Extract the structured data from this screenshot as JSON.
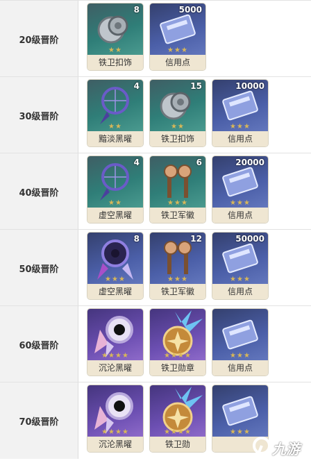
{
  "rows": [
    {
      "label": "20级晋阶",
      "items": [
        {
          "name": "铁卫扣饰",
          "count": "8",
          "icon": "coin-icon"
        },
        {
          "name": "信用点",
          "count": "5000",
          "icon": "credit-card-icon"
        }
      ]
    },
    {
      "label": "30级晋阶",
      "items": [
        {
          "name": "黯淡黑曜",
          "count": "4",
          "icon": "dreamcatcher-icon"
        },
        {
          "name": "铁卫扣饰",
          "count": "15",
          "icon": "coin-icon"
        },
        {
          "name": "信用点",
          "count": "10000",
          "icon": "credit-card-icon"
        }
      ]
    },
    {
      "label": "40级晋阶",
      "items": [
        {
          "name": "虚空黑曜",
          "count": "4",
          "icon": "dreamcatcher-icon"
        },
        {
          "name": "铁卫军徽",
          "count": "6",
          "icon": "insignia-icon"
        },
        {
          "name": "信用点",
          "count": "20000",
          "icon": "credit-card-icon"
        }
      ]
    },
    {
      "label": "50级晋阶",
      "items": [
        {
          "name": "虚空黑曜",
          "count": "8",
          "icon": "dreamcatcher-icon"
        },
        {
          "name": "铁卫军徽",
          "count": "12",
          "icon": "insignia-icon"
        },
        {
          "name": "信用点",
          "count": "50000",
          "icon": "credit-card-icon"
        }
      ]
    },
    {
      "label": "60级晋阶",
      "items": [
        {
          "name": "沉沦黑曜",
          "count": "",
          "icon": "dreamcatcher-icon"
        },
        {
          "name": "铁卫勋章",
          "count": "",
          "icon": "medal-icon"
        },
        {
          "name": "信用点",
          "count": "",
          "icon": "credit-card-icon"
        }
      ]
    },
    {
      "label": "70级晋阶",
      "items": [
        {
          "name": "沉沦黑曜",
          "count": "",
          "icon": "dreamcatcher-icon"
        },
        {
          "name": "铁卫勋",
          "count": "",
          "icon": "medal-icon"
        },
        {
          "name": "",
          "count": "",
          "icon": "credit-card-icon"
        }
      ]
    }
  ],
  "watermark": {
    "text": "九游"
  },
  "colors": {
    "label_bg": "#f2f2f2",
    "name_bg": "#efe6d2",
    "star": "#d8b758"
  }
}
